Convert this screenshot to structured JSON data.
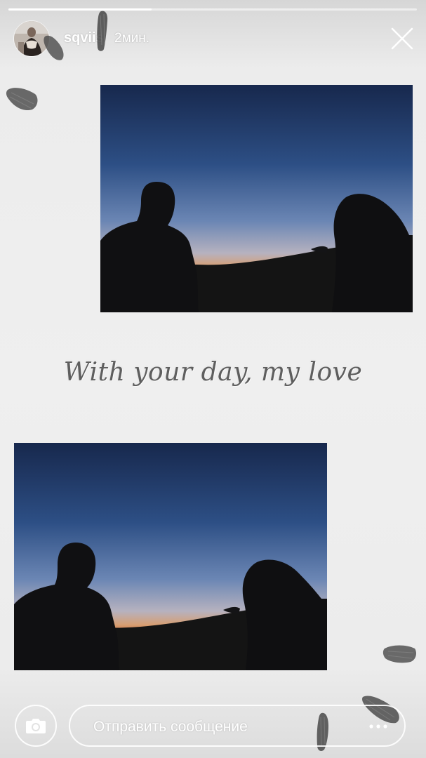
{
  "story": {
    "progress": 0.35,
    "colors": {
      "accent": "#ffffff",
      "caption": "#5e5e5e",
      "background": "#efefef"
    }
  },
  "header": {
    "username": "sqviis",
    "timestamp": "2мин.",
    "avatar_icon": "avatar-photo",
    "close_icon": "close-icon"
  },
  "caption": {
    "text": "With your day, my love"
  },
  "footer": {
    "camera_icon": "camera-icon",
    "message_placeholder": "Отправить сообщение",
    "more_icon": "more-options-icon"
  }
}
